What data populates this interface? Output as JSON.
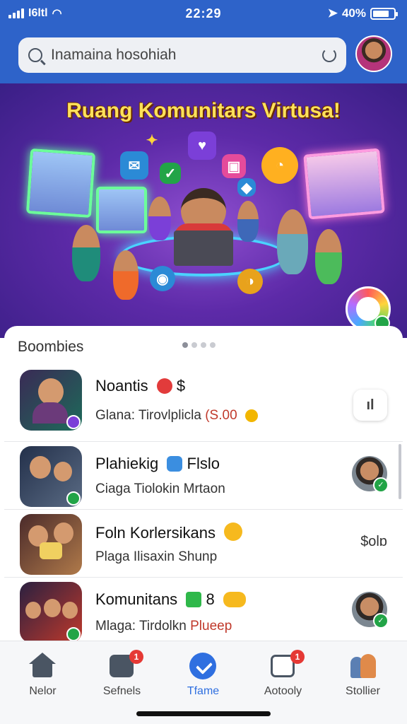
{
  "status_bar": {
    "carrier": "Ɩ6ltl",
    "time": "22:29",
    "battery_text": "40%",
    "battery_level": 0.8
  },
  "search": {
    "value": "Inamaina hosohiah",
    "placeholder": "Inamaina hosohiah"
  },
  "banner": {
    "title": "Ruang Komunitars Virtusa!"
  },
  "card": {
    "title": "Boombies",
    "carousel_pages": 4,
    "carousel_active": 1
  },
  "rows": [
    {
      "title": "Noantis",
      "title_suffix": "$",
      "subtitle": "Glana: Tirovlplicla",
      "price": "(S.00",
      "right": "ıl",
      "accent": "#7b3fd8"
    },
    {
      "title": "Plahiekig",
      "title_suffix": "Flslo",
      "subtitle": "Ciaga Tiolokin Mrtaon",
      "accent": "#22a447"
    },
    {
      "title": "Foln Korlersikans",
      "subtitle": "Plaga Ilisaxin Shunp",
      "right": "$olɒ",
      "accent": "#c0392b"
    },
    {
      "title": "Komunitans",
      "title_suffix": "8",
      "subtitle_prefix": "Mlaga: Tirdolkn ",
      "subtitle_highlight": "Plueep",
      "accent": "#22a447"
    }
  ],
  "nav": [
    {
      "label": "Nelor",
      "icon": "home-icon",
      "badge": ""
    },
    {
      "label": "Sefnels",
      "icon": "chat-icon",
      "badge": "1"
    },
    {
      "label": "Tfame",
      "icon": "check-icon",
      "badge": "",
      "active": true
    },
    {
      "label": "Aotooly",
      "icon": "activity-icon",
      "badge": "1"
    },
    {
      "label": "Stollier",
      "icon": "people-icon",
      "badge": ""
    }
  ],
  "colors": {
    "header": "#2e63c9",
    "banner": "#5d2aa8",
    "active_nav": "#2f6fe0",
    "badge": "#e53935"
  }
}
